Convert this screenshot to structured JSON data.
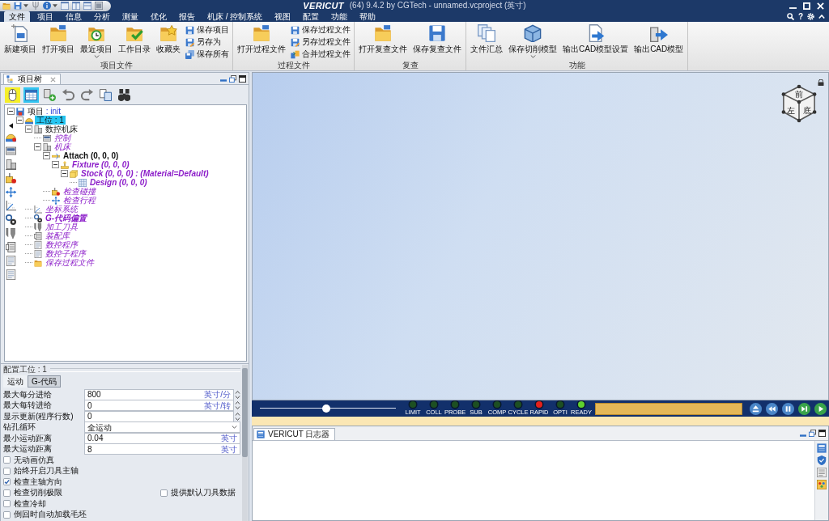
{
  "title_bar": {
    "logo": "VERICUT",
    "title": "(64) 9.4.2 by CGTech - unnamed.vcproject (英寸)"
  },
  "menu_bar": {
    "tabs": [
      {
        "label": "文件",
        "selected": true
      },
      {
        "label": "项目",
        "selected": false
      },
      {
        "label": "信息",
        "selected": false
      },
      {
        "label": "分析",
        "selected": false
      },
      {
        "label": "测量",
        "selected": false
      },
      {
        "label": "优化",
        "selected": false
      },
      {
        "label": "报告",
        "selected": false
      },
      {
        "label": "机床 / 控制系统",
        "selected": false
      },
      {
        "label": "视图",
        "selected": false
      },
      {
        "label": "配置",
        "selected": false
      },
      {
        "label": "功能",
        "selected": false
      },
      {
        "label": "帮助",
        "selected": false
      }
    ],
    "help": "?"
  },
  "ribbon": [
    {
      "label": "项目文件",
      "large": [
        {
          "label": "新建项目",
          "dropdown": false
        },
        {
          "label": "打开项目",
          "dropdown": false
        },
        {
          "label": "最近项目",
          "dropdown": true
        },
        {
          "label": "工作目录",
          "dropdown": false
        },
        {
          "label": "收藏夹",
          "dropdown": false
        }
      ],
      "small": [
        "保存项目",
        "另存为",
        "保存所有"
      ]
    },
    {
      "label": "过程文件",
      "large": [
        {
          "label": "打开过程文件",
          "dropdown": false
        }
      ],
      "small": [
        "保存过程文件",
        "另存过程文件",
        "合并过程文件"
      ]
    },
    {
      "label": "复查",
      "large": [
        {
          "label": "打开复查文件",
          "dropdown": false
        },
        {
          "label": "保存复查文件",
          "dropdown": false
        }
      ]
    },
    {
      "label": "功能",
      "large": [
        {
          "label": "文件汇总",
          "dropdown": false
        },
        {
          "label": "保存切削模型",
          "dropdown": true
        },
        {
          "label": "输出CAD模型设置",
          "dropdown": false
        },
        {
          "label": "输出CAD模型",
          "dropdown": false
        }
      ]
    }
  ],
  "project_tree": {
    "tab": "项目树",
    "toolbar": [
      {
        "active": true
      },
      {
        "active": true
      },
      {
        "active": false
      },
      {
        "active": false
      },
      {
        "active": false
      },
      {
        "active": false
      },
      {
        "active": false
      }
    ],
    "nodes": [
      {
        "kind": "project",
        "label": "项目",
        "detail": ": init",
        "selected": false,
        "empty": false,
        "expanded": true,
        "children": [
          {
            "kind": "setup",
            "label": "工位 : 1",
            "selected": true,
            "empty": false,
            "expanded": true,
            "children": [
              {
                "kind": "machine",
                "label": "数控机床",
                "selected": false,
                "empty": false,
                "expanded": true,
                "children": [
                  {
                    "kind": "control",
                    "label": "控制",
                    "selected": false,
                    "empty": true
                  },
                  {
                    "kind": "base",
                    "label": "机床",
                    "selected": false,
                    "empty": true,
                    "expanded": true,
                    "children": [
                      {
                        "kind": "attach",
                        "label": "Attach (0, 0, 0)",
                        "selected": false,
                        "empty": false,
                        "expanded": true,
                        "children": [
                          {
                            "kind": "fixture",
                            "label": "Fixture (0, 0, 0)",
                            "selected": false,
                            "empty": true,
                            "expanded": true,
                            "children": [
                              {
                                "kind": "stock",
                                "label": "Stock (0, 0, 0) : (Material=Default)",
                                "selected": false,
                                "empty": true,
                                "expanded": true,
                                "children": [
                                  {
                                    "kind": "design",
                                    "label": "Design (0, 0, 0)",
                                    "selected": false,
                                    "empty": true
                                  }
                                ]
                              }
                            ]
                          }
                        ]
                      },
                      {
                        "kind": "collision",
                        "label": "检查碰撞",
                        "selected": false,
                        "empty": true
                      },
                      {
                        "kind": "travel",
                        "label": "检查行程",
                        "selected": false,
                        "empty": true
                      }
                    ]
                  }
                ]
              },
              {
                "kind": "csys",
                "label": "坐标系统",
                "selected": false,
                "empty": true
              },
              {
                "kind": "offsets",
                "label": "G-代码偏置",
                "selected": false,
                "empty": true
              },
              {
                "kind": "tools",
                "label": "加工刀具",
                "selected": false,
                "empty": true
              },
              {
                "kind": "library",
                "label": "装配库",
                "selected": false,
                "empty": true
              },
              {
                "kind": "program",
                "label": "数控程序",
                "selected": false,
                "empty": true
              },
              {
                "kind": "subprogram",
                "label": "数控子程序",
                "selected": false,
                "empty": true
              },
              {
                "kind": "save",
                "label": "保存过程文件",
                "selected": false,
                "empty": true
              }
            ]
          }
        ]
      }
    ]
  },
  "config_panel": {
    "header": "配置工位 : 1",
    "tabs": [
      {
        "label": "运动",
        "selected": true
      },
      {
        "label": "G-代码",
        "selected": false
      }
    ],
    "fields": [
      {
        "kind": "spinner",
        "label": "最大每分进给",
        "value": "800",
        "unit": "英寸/分"
      },
      {
        "kind": "spinner",
        "label": "最大每转进给",
        "value": "0",
        "unit": "英寸/转"
      },
      {
        "kind": "spinner",
        "label": "显示更新(程序行数)",
        "value": "0"
      },
      {
        "kind": "select",
        "label": "钻孔循环",
        "value": "全运动"
      },
      {
        "kind": "input",
        "label": "最小运动距离",
        "value": "0.04",
        "unit": "英寸"
      },
      {
        "kind": "input",
        "label": "最大运动距离",
        "value": "8",
        "unit": "英寸"
      }
    ],
    "checkbox_rows": [
      [
        {
          "label": "无动画仿真",
          "checked": false
        }
      ],
      [
        {
          "label": "始终开启刀具主轴",
          "checked": false
        }
      ],
      [
        {
          "label": "检查主轴方向",
          "checked": true
        }
      ],
      [
        {
          "label": "检查切削极限",
          "checked": false
        },
        {
          "label": "提供默认刀具数据",
          "checked": false
        }
      ],
      [
        {
          "label": "检查冷却",
          "checked": false
        }
      ],
      [
        {
          "label": "倒回时自动加载毛坯",
          "checked": false
        }
      ]
    ]
  },
  "viewport": {
    "view_cube": [
      "前",
      "左",
      "底"
    ]
  },
  "sim_controls": {
    "slider": {
      "level": 0.49
    },
    "indicators": [
      {
        "label": "LIMIT",
        "color": "#1d4f22"
      },
      {
        "label": "COLL",
        "color": "#1d4f22"
      },
      {
        "label": "PROBE",
        "color": "#1d4f22"
      },
      {
        "label": "SUB",
        "color": "#1d4f22"
      },
      {
        "label": "COMP",
        "color": "#1d4f22"
      },
      {
        "label": "CYCLE",
        "color": "#1d4f22"
      },
      {
        "label": "RAPID",
        "color": "#e3201b"
      },
      {
        "label": "OPTI",
        "color": "#1d4f22"
      },
      {
        "label": "READY",
        "color": "#5fd12e"
      }
    ],
    "progress": {
      "level": 1
    }
  },
  "log_panel": {
    "tab": "VERICUT 日志器"
  }
}
